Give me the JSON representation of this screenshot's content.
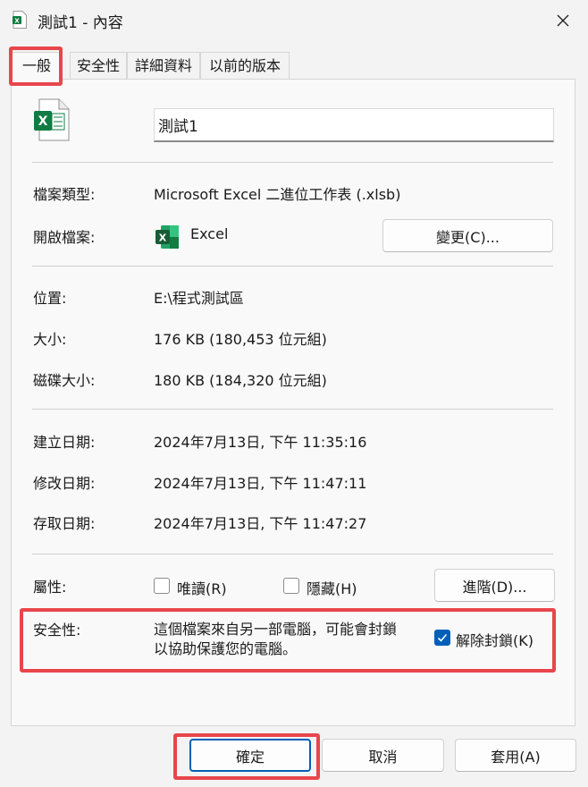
{
  "window": {
    "title": "測試1 - 內容",
    "close_label": "close"
  },
  "tabs": [
    {
      "label": "一般"
    },
    {
      "label": "安全性"
    },
    {
      "label": "詳細資料"
    },
    {
      "label": "以前的版本"
    }
  ],
  "file": {
    "name": "測試1"
  },
  "type": {
    "label": "檔案類型:",
    "value": "Microsoft Excel 二進位工作表 (.xlsb)"
  },
  "opens_with": {
    "label": "開啟檔案:",
    "app": "Excel",
    "change_button": "變更(C)..."
  },
  "location": {
    "label": "位置:",
    "value": "E:\\程式測試區"
  },
  "size": {
    "label": "大小:",
    "value": "176 KB (180,453 位元組)"
  },
  "size_on_disk": {
    "label": "磁碟大小:",
    "value": "180 KB (184,320 位元組)"
  },
  "created": {
    "label": "建立日期:",
    "value": "2024年7月13日, 下午 11:35:16"
  },
  "modified": {
    "label": "修改日期:",
    "value": "2024年7月13日, 下午 11:47:11"
  },
  "accessed": {
    "label": "存取日期:",
    "value": "2024年7月13日, 下午 11:47:27"
  },
  "attributes": {
    "label": "屬性:",
    "readonly_label": "唯讀(R)",
    "readonly_checked": false,
    "hidden_label": "隱藏(H)",
    "hidden_checked": false,
    "advanced_button": "進階(D)..."
  },
  "security": {
    "label": "安全性:",
    "message_line1": "這個檔案來自另一部電腦，可能會封鎖",
    "message_line2": "以協助保護您的電腦。",
    "unblock_label": "解除封鎖(K)",
    "unblock_checked": true
  },
  "buttons": {
    "ok": "確定",
    "cancel": "取消",
    "apply": "套用(A)"
  },
  "colors": {
    "accent": "#005fb8",
    "highlight": "#e8464c",
    "excel_green": "#107c41"
  }
}
